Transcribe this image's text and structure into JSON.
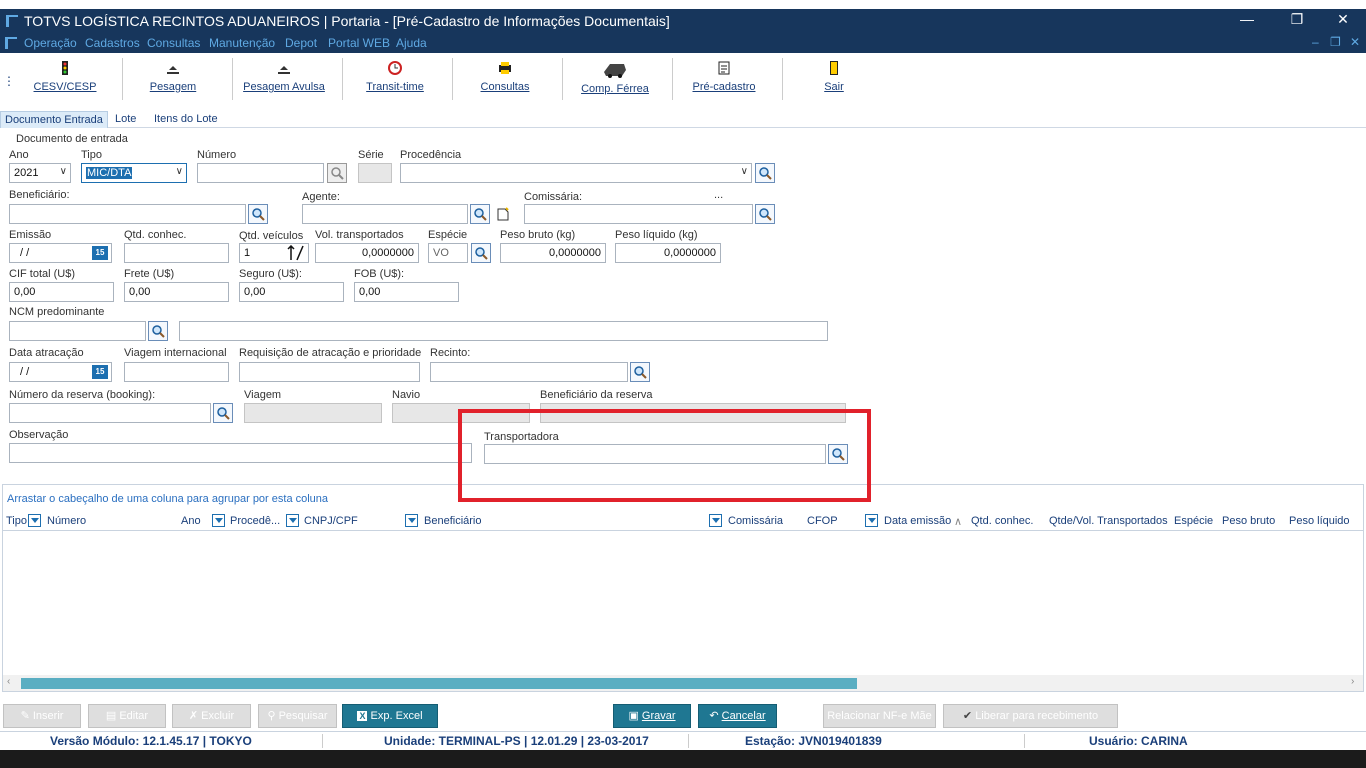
{
  "window": {
    "title": "TOTVS LOGÍSTICA RECINTOS ADUANEIROS | Portaria - [Pré-Cadastro de Informações Documentais]"
  },
  "menu": [
    "Operação",
    "Cadastros",
    "Consultas",
    "Manutenção",
    "Depot",
    "Portal WEB",
    "Ajuda"
  ],
  "toolbar": [
    {
      "label": "CESV/CESP",
      "icon": "traffic-light-icon"
    },
    {
      "label": "Pesagem",
      "icon": "scale-icon"
    },
    {
      "label": "Pesagem Avulsa",
      "icon": "scale-icon"
    },
    {
      "label": "Transit-time",
      "icon": "clock-icon"
    },
    {
      "label": "Consultas",
      "icon": "printer-icon"
    },
    {
      "label": "Comp. Férrea",
      "icon": "train-icon"
    },
    {
      "label": "Pré-cadastro",
      "icon": "document-icon"
    },
    {
      "label": "Sair",
      "icon": "door-icon"
    }
  ],
  "tabs": [
    "Documento Entrada",
    "Lote",
    "Itens do Lote"
  ],
  "section_title": "Documento de entrada",
  "labels": {
    "ano": "Ano",
    "tipo": "Tipo",
    "numero": "Número",
    "serie": "Série",
    "procedencia": "Procedência",
    "beneficiario": "Beneficiário:",
    "agente": "Agente:",
    "comissaria": "Comissária:",
    "ellipsis": "...",
    "emissao": "Emissão",
    "qtd_conhec": "Qtd. conhec.",
    "qtd_veiculos": "Qtd. veículos",
    "vol_transportados": "Vol. transportados",
    "especie": "Espécie",
    "peso_bruto": "Peso bruto (kg)",
    "peso_liquido": "Peso líquido (kg)",
    "cif_total": "CIF total (U$)",
    "frete": "Frete (U$)",
    "seguro": "Seguro (U$):",
    "fob": "FOB (U$):",
    "ncm": "NCM predominante",
    "data_atracacao": "Data atracação",
    "viagem_internacional": "Viagem internacional",
    "requisicao": "Requisição de atracação e prioridade",
    "recinto": "Recinto:",
    "numero_reserva": "Número da reserva (booking):",
    "viagem": "Viagem",
    "navio": "Navio",
    "beneficiario_reserva": "Beneficiário da reserva",
    "observacao": "Observação",
    "transportadora": "Transportadora"
  },
  "values": {
    "ano": "2021",
    "tipo": "MIC/DTA",
    "emissao": "/ /",
    "qtd_veiculos": "1",
    "vol_transportados": "0,0000000",
    "especie": "VO",
    "peso_bruto": "0,0000000",
    "peso_liquido": "0,0000000",
    "cif_total": "0,00",
    "frete": "0,00",
    "seguro": "0,00",
    "fob": "0,00",
    "data_atracacao": "/ /",
    "calendar": "15"
  },
  "grid": {
    "group_hint": "Arrastar o cabeçalho de uma coluna para agrupar por esta coluna",
    "columns": [
      "Tipo",
      "Número",
      "Ano",
      "Procedê...",
      "CNPJ/CPF",
      "Beneficiário",
      "Comissária",
      "CFOP",
      "Data emissão",
      "Qtd. conhec.",
      "Qtde/Vol. Transportados",
      "Espécie",
      "Peso bruto",
      "Peso líquido"
    ]
  },
  "buttons": {
    "inserir": "Inserir",
    "editar": "Editar",
    "excluir": "Excluir",
    "pesquisar": "Pesquisar",
    "exp_excel": "Exp. Excel",
    "gravar": "Gravar",
    "cancelar": "Cancelar",
    "relacionar": "Relacionar NF-e Mãe",
    "liberar": "Liberar para recebimento"
  },
  "status": {
    "versao": "Versão Módulo:  12.1.45.17  |  TOKYO",
    "unidade": "Unidade: TERMINAL-PS | 12.01.29 | 23-03-2017",
    "estacao": "Estação: JVN019401839",
    "usuario": "Usuário: CARINA"
  },
  "colors": {
    "titlebar": "#17365c",
    "accent": "#1f7792",
    "highlight": "#e1212b",
    "link": "#1a3f7a"
  }
}
